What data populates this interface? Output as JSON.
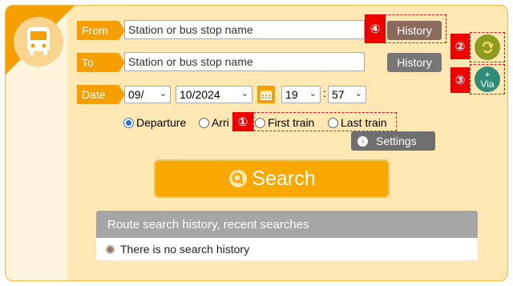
{
  "form": {
    "from": {
      "label": "From",
      "placeholder": "Station or bus stop name",
      "history": "History"
    },
    "to": {
      "label": "To",
      "placeholder": "Station or bus stop name",
      "history": "History"
    },
    "date": {
      "label": "Date",
      "day": "09/",
      "month_year": "10/2024",
      "hour": "19",
      "separator": ":",
      "minute": "57"
    },
    "time_type": {
      "departure": "Departure",
      "arrival": "Arri",
      "first_train": "First train",
      "last_train": "Last train",
      "selected": "Departure"
    },
    "settings": "Settings",
    "search": "Search",
    "via": {
      "plus": "+",
      "label": "Via"
    }
  },
  "annotations": {
    "n1": "①",
    "n2": "②",
    "n3": "③",
    "n4": "④"
  },
  "history": {
    "title": "Route search history, recent searches",
    "empty": "There is no search history"
  },
  "colors": {
    "accent": "#f5a000",
    "panel_bg": "#ffe8b3",
    "annotation": "#e00000",
    "swap_button": "#8d9b1f",
    "via_button": "#2e8c77"
  },
  "icons": {
    "bus": "bus-icon",
    "calendar": "calendar-icon",
    "swap": "swap-icon",
    "search": "search-icon",
    "settings": "chevron-right-icon"
  }
}
